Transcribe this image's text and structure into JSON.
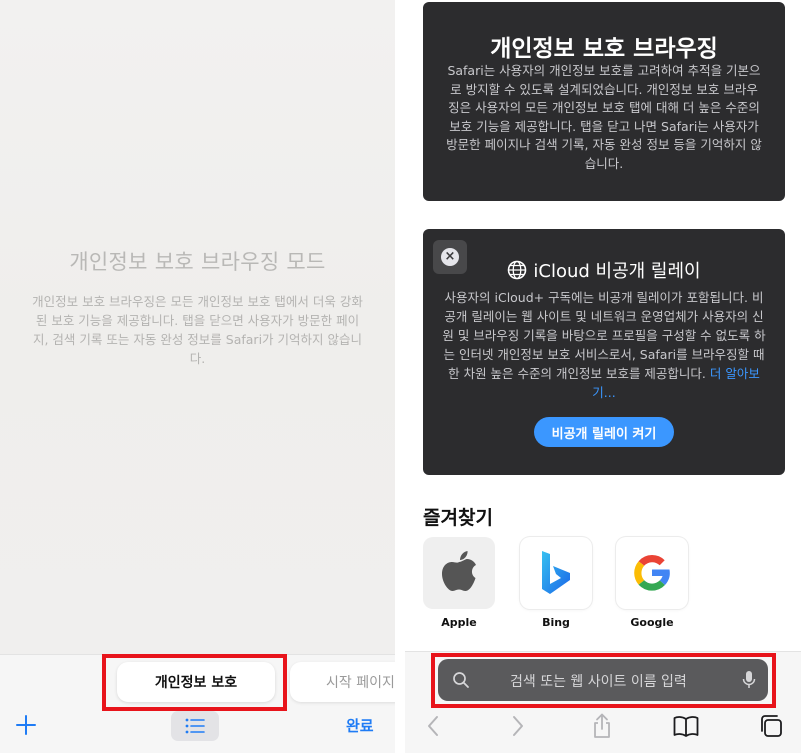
{
  "left_panel": {
    "title": "개인정보 보호 브라우징 모드",
    "description": "개인정보 보호 브라우징은 모든 개인정보 보호 탭에서 더욱 강화된 보호 기능을 제공합니다. 탭을 닫으면 사용자가 방문한 페이지, 검색 기록 또는 자동 완성 정보를 Safari가 기억하지 않습니다.",
    "tab_groups": [
      {
        "label": "개인정보 보호",
        "selected": true
      },
      {
        "label": "시작 페이지",
        "selected": false
      }
    ],
    "toolbar": {
      "add_icon": "plus-icon",
      "list_icon": "list-icon",
      "done_label": "완료"
    }
  },
  "right_panel": {
    "private_card": {
      "title": "개인정보 보호 브라우징",
      "description": "Safari는 사용자의 개인정보 보호를 고려하여 추적을 기본으로 방지할 수 있도록 설계되었습니다. 개인정보 보호 브라우징은 사용자의 모든 개인정보 보호 탭에 대해 더 높은 수준의 보호 기능을 제공합니다. 탭을 닫고 나면 Safari는 사용자가 방문한 페이지나 검색 기록, 자동 완성 정보 등을 기억하지 않습니다."
    },
    "relay_card": {
      "title": "iCloud 비공개 릴레이",
      "description": "사용자의 iCloud+ 구독에는 비공개 릴레이가 포함됩니다. 비공개 릴레이는 웹 사이트 및 네트워크 운영업체가 사용자의 신원 및 브라우징 기록을 바탕으로 프로필을 구성할 수 없도록 하는 인터넷 개인정보 보호 서비스로서, Safari를 브라우징할 때 한 차원 높은 수준의 개인정보 보호를 제공합니다.",
      "learn_more": "더 알아보기...",
      "button_label": "비공개 릴레이 켜기"
    },
    "favorites": {
      "heading": "즐겨찾기",
      "items": [
        {
          "label": "Apple",
          "icon": "apple-logo-icon"
        },
        {
          "label": "Bing",
          "icon": "bing-logo-icon"
        },
        {
          "label": "Google",
          "icon": "google-logo-icon"
        }
      ]
    },
    "search": {
      "placeholder": "검색 또는 웹 사이트 이름 입력"
    },
    "toolbar": {
      "icons": [
        "back-icon",
        "forward-icon",
        "share-icon",
        "bookmarks-icon",
        "tabs-icon"
      ]
    }
  },
  "colors": {
    "accent": "#1f7cf5",
    "highlight_box": "#e8141b",
    "card_bg": "#2c2c2e",
    "relay_button": "#3b97ff"
  }
}
